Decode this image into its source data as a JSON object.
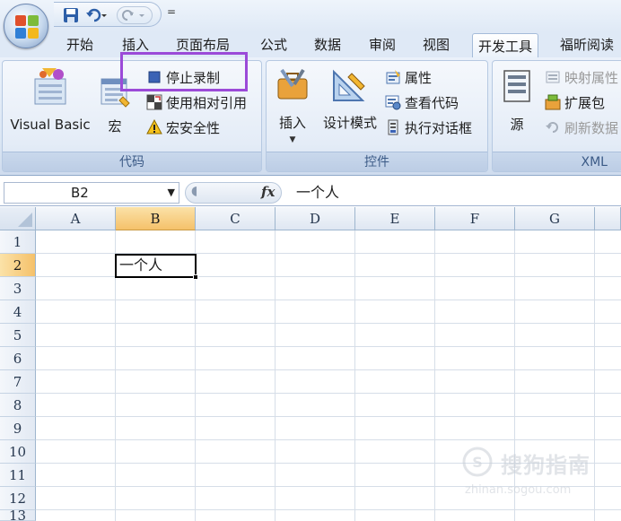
{
  "qat": {
    "more_glyph": "="
  },
  "tabs": [
    {
      "label": "开始"
    },
    {
      "label": "插入"
    },
    {
      "label": "页面布局"
    },
    {
      "label": "公式"
    },
    {
      "label": "数据"
    },
    {
      "label": "审阅"
    },
    {
      "label": "视图"
    },
    {
      "label": "开发工具",
      "active": true
    },
    {
      "label": "福昕阅读"
    }
  ],
  "ribbon": {
    "code_group": {
      "label": "代码",
      "visual_basic": "Visual Basic",
      "macro": "宏",
      "stop_recording": "停止录制",
      "relative_reference": "使用相对引用",
      "macro_security": "宏安全性"
    },
    "controls_group": {
      "label": "控件",
      "insert": "插入",
      "design_mode": "设计模式",
      "properties": "属性",
      "view_code": "查看代码",
      "run_dialog": "执行对话框"
    },
    "xml_group": {
      "label": "XML",
      "source": "源",
      "map_properties": "映射属性",
      "expansion_packs": "扩展包",
      "refresh_data": "刷新数据"
    }
  },
  "formula_bar": {
    "name_box": "B2",
    "formula": "一个人"
  },
  "sheet": {
    "columns": [
      "A",
      "B",
      "C",
      "D",
      "E",
      "F",
      "G"
    ],
    "rows": [
      "1",
      "2",
      "3",
      "4",
      "5",
      "6",
      "7",
      "8",
      "9",
      "10",
      "11",
      "12",
      "13"
    ],
    "selected_column": "B",
    "selected_row": "2",
    "active_cell_value": "一个人"
  },
  "watermark": {
    "name": "搜狗指南",
    "url": "zhinan.sogou.com"
  },
  "colors": {
    "ribbon_bg": "#dbe6f4",
    "group_label": "#3b5a86",
    "highlight_box": "#9b4ad8",
    "header_selected": "#f5c16a",
    "gridline": "#d6dee8"
  }
}
